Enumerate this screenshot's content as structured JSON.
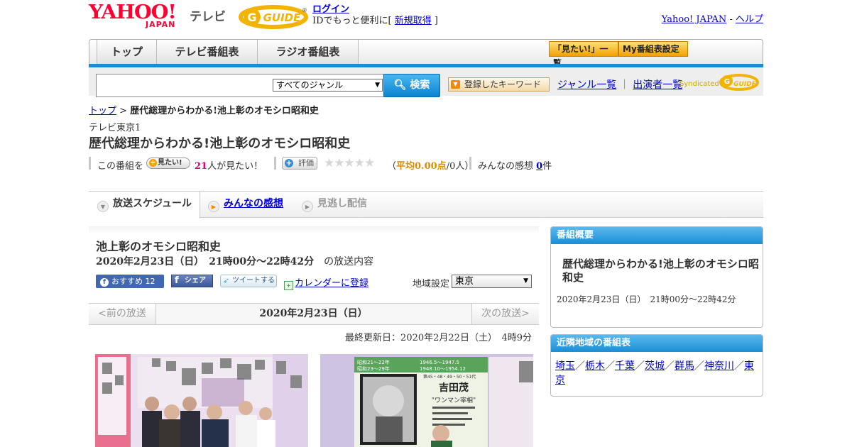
{
  "header": {
    "yahoo_logo_text": "YAHOO!",
    "japan_text": "JAPAN",
    "tv_text": "テレビ",
    "gguide_text": "G GUIDE",
    "login": "ログイン",
    "login_note_pre": "IDでもっと便利に[ ",
    "register": "新規取得",
    "login_note_post": " ]",
    "yahoo_japan": "Yahoo! JAPAN",
    "separator": " - ",
    "help": "ヘルプ"
  },
  "nav": {
    "tabs": [
      "トップ",
      "テレビ番組表",
      "ラジオ番組表"
    ],
    "wishlist": "「見たい!」一覧",
    "mylist": "My番組表設定"
  },
  "search": {
    "placeholder": "",
    "genre_selected": "すべてのジャンル",
    "search_button": "検索",
    "keyword_button": "登録したキーワード",
    "genre_link": "ジャンル一覧",
    "link_separator": "｜",
    "performer_link": "出演者一覧",
    "syndicated": "Syndicated",
    "syndicated_logo": "G GUIDE"
  },
  "breadcrumb": {
    "home": "トップ",
    "separator": " > ",
    "current": "歴代総理からわかる!池上彰のオモシロ昭和史"
  },
  "program": {
    "channel": "テレビ東京1",
    "title": "歴代総理からわかる!池上彰のオモシロ昭和史",
    "want_label": "この番組を",
    "want_button": "見たい!",
    "want_count": "21",
    "want_suffix": "人が見たい！",
    "rate_button": "評価",
    "stars": "★★★★★",
    "rating_value": 0,
    "avg_open": "（",
    "avg_label": "平均0.00点",
    "avg_suffix": "/0人）",
    "reviews_label": "みんなの感想 ",
    "reviews_count": "0",
    "reviews_suffix": "件"
  },
  "tabs": {
    "schedule": "放送スケジュール",
    "impressions": "みんなの感想",
    "vod": "見逃し配信"
  },
  "broadcast": {
    "title": "池上彰のオモシロ昭和史",
    "time": "2020年2月23日（日）　21時00分～22時42分",
    "time_suffix": "　の放送内容",
    "fb_recommend": "おすすめ 12",
    "fb_share": "シェア",
    "tweet": "ツイートする",
    "calendar": "カレンダーに登録",
    "region_label": "地域設定",
    "region_selected": "東京",
    "prev": "<前の放送",
    "date": "2020年2月23日（日）",
    "next": "次の放送>",
    "updated": "最終更新日：2020年2月22日（土）　4時9分"
  },
  "sidebar": {
    "summary_heading": "番組概要",
    "summary_title": "歴代総理からわかる!池上彰のオモシロ昭和史",
    "summary_time": "2020年2月23日（日）　21時00分～22時42分",
    "nearby_heading": "近隣地域の番組表",
    "nearby": [
      "埼玉",
      "栃木",
      "千葉",
      "茨城",
      "群馬",
      "神奈川",
      "東京"
    ],
    "nearby_separator": "／"
  },
  "thumb2": {
    "era_top": "昭和21～22年",
    "era_bottom": "昭和23～29年",
    "years_top": "1946.5～1947.5",
    "years_bottom": "1948.10～1954.12",
    "number": "第45・48・49・50・51代",
    "name": "吉田茂",
    "nickname": "\"ワンマン宰相\""
  },
  "colors": {
    "link": "#0000cc",
    "accent_blue": "#1b8ccf",
    "want_count": "#e0007a",
    "rating": "#e08a00",
    "yahoo_red": "#ff0033"
  }
}
